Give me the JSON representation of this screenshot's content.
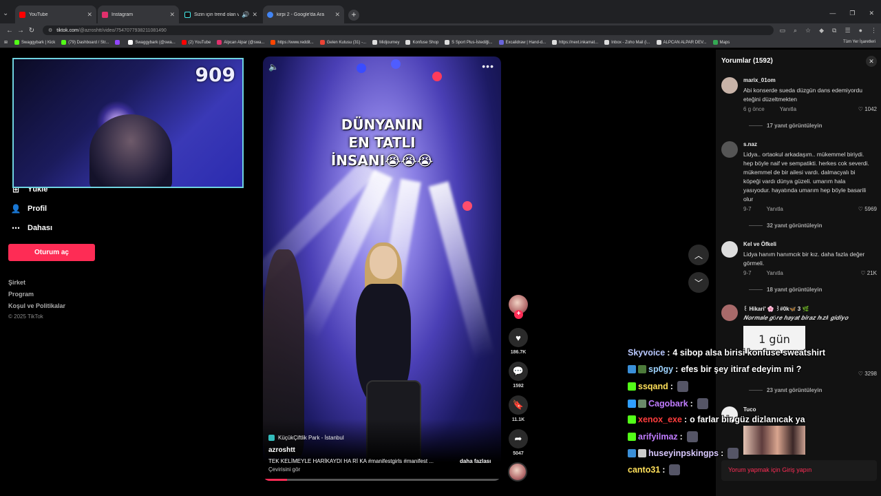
{
  "browser": {
    "tabs": [
      {
        "title": "YouTube",
        "color": "#ff0000"
      },
      {
        "title": "Instagram",
        "color": "#e1306c"
      },
      {
        "title": "Sizin için trend olan videola",
        "color": "#111111"
      },
      {
        "title": "kirpi 2 - Google'da Ara",
        "color": "#4285f4"
      }
    ],
    "url_host": "tiktok.com",
    "url_path": "/@azroshtt/video/7547077938211081490",
    "bookmarks": [
      {
        "label": "Swaggybark | Kick",
        "color": "#53fc18"
      },
      {
        "label": "(79) Dashboard / Str...",
        "color": "#53fc18"
      },
      {
        "label": "",
        "color": "#9146ff"
      },
      {
        "label": "Swaggybark (@swa...",
        "color": "#ffffff"
      },
      {
        "label": "(2) YouTube",
        "color": "#ff0000"
      },
      {
        "label": "Alpcan Alpar (@swa...",
        "color": "#e1306c"
      },
      {
        "label": "https://www.reddit...",
        "color": "#ff4500"
      },
      {
        "label": "Gelen Kutusu (31) -...",
        "color": "#ea4335"
      },
      {
        "label": "Midjourney",
        "color": "#dddddd"
      },
      {
        "label": "Konfuse Shop",
        "color": "#dddddd"
      },
      {
        "label": "S Sport Plus-İstediği...",
        "color": "#dddddd"
      },
      {
        "label": "Excalidraw | Hand-d...",
        "color": "#6965db"
      },
      {
        "label": "https://next.inkamat...",
        "color": "#dddddd"
      },
      {
        "label": "Inbox - Zoho Mail (i...",
        "color": "#dddddd"
      },
      {
        "label": "ALPCAN ALPAR DEV...",
        "color": "#dddddd"
      },
      {
        "label": "Maps",
        "color": "#34a853"
      }
    ],
    "bookmarks_all": "Tüm Yer İşaretleri"
  },
  "sidebar": {
    "items": [
      {
        "label": "Yükle",
        "icon": "upload-icon"
      },
      {
        "label": "Profil",
        "icon": "person-icon"
      },
      {
        "label": "Dahası",
        "icon": "more-icon"
      }
    ],
    "login_label": "Oturum aç",
    "footer": [
      "Şirket",
      "Program",
      "Koşul ve Politikalar"
    ],
    "copyright": "© 2025 TikTok"
  },
  "webcam": {
    "counter": "909"
  },
  "video": {
    "overlay_text_lines": [
      "DÜNYANIN",
      "EN TATLI",
      "İNSANI😭😭😭"
    ],
    "location": "KüçükÇiftlik Park - İstanbul",
    "author": "azroshtt",
    "caption": "TEK KELİMEYLE HARİKAYDI HA Rİ KA #manifestgirls #manifest ...",
    "more_label": "daha fazlası",
    "translate_label": "Çevirisini gör",
    "progress": 0.1
  },
  "actions": [
    {
      "icon": "heart-icon",
      "glyph": "♥",
      "count": "186.7K"
    },
    {
      "icon": "comment-icon",
      "glyph": "💬",
      "count": "1592"
    },
    {
      "icon": "bookmark-icon",
      "glyph": "🔖",
      "count": "11.1K"
    },
    {
      "icon": "share-icon",
      "glyph": "➦",
      "count": "5047"
    }
  ],
  "comments": {
    "header": "Yorumlar (1592)",
    "items": [
      {
        "user": "marix_01om",
        "text": "Abi konserde sueda düzgün dans edemiyordu eteğini düzeltmekten",
        "date": "6 g önce",
        "reply": "Yanıtla",
        "likes": "1042",
        "replies": "17 yanıt görüntüleyin",
        "av": "#c8b3a8"
      },
      {
        "user": "s.naz",
        "text": "Lidya.. ortaokul arkadaşım.. mükemmel biriydi. hep böyle naif ve sempatikti. herkes cok severdi. mükemmel de bir ailesi vardı. dalmacyalı bi köpeği vardı dünya güzeli. umarım hala yasıyodur. hayatında umarım hep böyle basarili olur",
        "date": "9-7",
        "reply": "Yanıtla",
        "likes": "5969",
        "replies": "32 yanıt görüntüleyin",
        "av": "#555555"
      },
      {
        "user": "Kel ve Öfkeli",
        "text": "Lidya hanım hanımcık bir kız. daha fazla değer görmeli.",
        "date": "9-7",
        "reply": "Yanıtla",
        "likes": "21K",
        "replies": "18 yanıt görüntüleyin",
        "av": "#dddddd"
      },
      {
        "user": "꒰ Hikari' 🌸 ꒱#0k🦋 3 🌿",
        "text": "𝑵𝒐𝒓𝒎𝒂𝒍𝒆 𝒈ö𝒓𝒆 𝒉𝒂𝒚𝒂𝒕 𝒃𝒊𝒓𝒂𝒛 𝒉ı𝒛𝒍ı 𝒈𝒊𝒅𝒊𝒚𝒐",
        "image_text": "1 gün",
        "likes": "3298",
        "replies": "23 yanıt görüntüleyin",
        "av": "#a86a6a"
      },
      {
        "user": "Tuco",
        "av": "#eeeeee"
      }
    ],
    "login_prompt": "Yorum yapmak için Giriş yapın"
  },
  "chat": [
    {
      "user": "Skyvoice",
      "color": "#b9c8ff",
      "msg": "4 sibop alsa birisi konfuse sweatshirt",
      "badges": []
    },
    {
      "user": "sp0gy",
      "color": "#9fd4ff",
      "msg": "efes bir şey itiraf edeyim mi ?",
      "badges": [
        "#3a8fd8",
        "#4c7a3a"
      ]
    },
    {
      "user": "ssqand",
      "color": "#ffe05a",
      "msg": "",
      "badges": [
        "#53fc18"
      ],
      "emote": true
    },
    {
      "user": "Cagobark",
      "color": "#c07cff",
      "msg": "",
      "badges": [
        "#2f9fff",
        "#6a8a6a"
      ],
      "emote": true
    },
    {
      "user": "xenox_exe",
      "color": "#ff3d3d",
      "msg": "o farlar bir güz dizlanıcak ya",
      "badges": [
        "#53fc18"
      ]
    },
    {
      "user": "arifyilmaz",
      "color": "#c07cff",
      "msg": "",
      "badges": [
        "#53fc18"
      ],
      "emote": true
    },
    {
      "user": "huseyinpskingps",
      "color": "#d9c9ff",
      "msg": "",
      "badges": [
        "#3a8fd8",
        "#cccccc"
      ],
      "emote": true
    },
    {
      "user": "canto31",
      "color": "#ffe05a",
      "msg": "",
      "badges": [],
      "emote": true
    }
  ]
}
